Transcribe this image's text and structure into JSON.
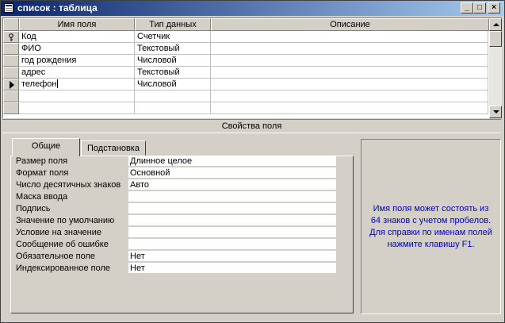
{
  "window": {
    "title": "список : таблица"
  },
  "grid": {
    "columns": [
      "Имя поля",
      "Тип данных",
      "Описание"
    ],
    "rows": [
      {
        "name": "Код",
        "type": "Счетчик",
        "desc": ""
      },
      {
        "name": "ФИО",
        "type": "Текстовый",
        "desc": ""
      },
      {
        "name": "год рождения",
        "type": "Числовой",
        "desc": ""
      },
      {
        "name": "адрес",
        "type": "Текстовый",
        "desc": ""
      },
      {
        "name": "телефон",
        "type": "Числовой",
        "desc": ""
      }
    ]
  },
  "properties": {
    "header": "Свойства поля",
    "tabs": [
      "Общие",
      "Подстановка"
    ],
    "items": [
      {
        "label": "Размер поля",
        "value": "Длинное целое"
      },
      {
        "label": "Формат поля",
        "value": "Основной"
      },
      {
        "label": "Число десятичных знаков",
        "value": "Авто"
      },
      {
        "label": "Маска ввода",
        "value": ""
      },
      {
        "label": "Подпись",
        "value": ""
      },
      {
        "label": "Значение по умолчанию",
        "value": ""
      },
      {
        "label": "Условие на значение",
        "value": ""
      },
      {
        "label": "Сообщение об ошибке",
        "value": ""
      },
      {
        "label": "Обязательное поле",
        "value": "Нет"
      },
      {
        "label": "Индексированное поле",
        "value": "Нет"
      }
    ]
  },
  "help": {
    "line1": "Имя поля может состоять из",
    "line2": "64 знаков с учетом пробелов.",
    "line3": "Для справки по именам полей",
    "line4": "нажмите клавишу F1."
  },
  "icons": {
    "primary_key": "key-icon",
    "current_row": "row-pointer-icon"
  },
  "colors": {
    "title_start": "#0a246a",
    "title_end": "#a6caf0",
    "help_text": "#0000c0",
    "face": "#d4d0c8"
  }
}
